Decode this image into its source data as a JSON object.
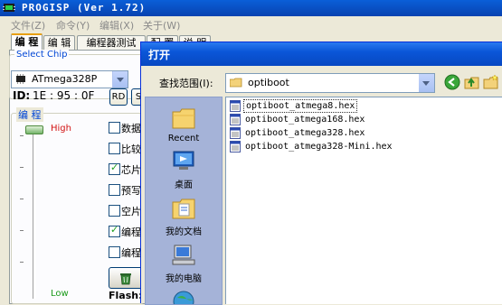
{
  "app": {
    "title": "PROGISP (Ver 1.72)",
    "menu": [
      "文件(Z)",
      "命令(Y)",
      "编辑(X)",
      "关于(W)"
    ],
    "tabs": [
      "编 程",
      "编 辑",
      "编程器测试",
      "配 置",
      "说 明"
    ],
    "select_chip_label": "Select Chip",
    "chip": "ATmega328P",
    "id_label": "ID:",
    "id_value": "1E : 95 : 0F",
    "rd_button": "RD",
    "s_button": "S",
    "program_group_label": "编 程",
    "high_label": "High",
    "low_label": "Low",
    "options": [
      {
        "label": "数据",
        "checked": false
      },
      {
        "label": "比较",
        "checked": false
      },
      {
        "label": "芯片",
        "checked": true
      },
      {
        "label": "预写",
        "checked": false
      },
      {
        "label": "空片",
        "checked": false
      },
      {
        "label": "编程",
        "checked": true
      },
      {
        "label": "编程",
        "checked": false
      }
    ],
    "flash_label": "Flash:("
  },
  "dialog": {
    "title": "打开",
    "lookin_label": "查找范围(I):",
    "path": "optiboot",
    "places": [
      "Recent",
      "桌面",
      "我的文档",
      "我的电脑"
    ],
    "files": [
      "optiboot_atmega8.hex",
      "optiboot_atmega168.hex",
      "optiboot_atmega328.hex",
      "optiboot_atmega328-Mini.hex"
    ],
    "selected_file_index": 0
  },
  "colors": {
    "titlebar": "#0848c2",
    "high": "#d21313",
    "low": "#1a9a1a",
    "places_bg": "#a5b3d8"
  }
}
